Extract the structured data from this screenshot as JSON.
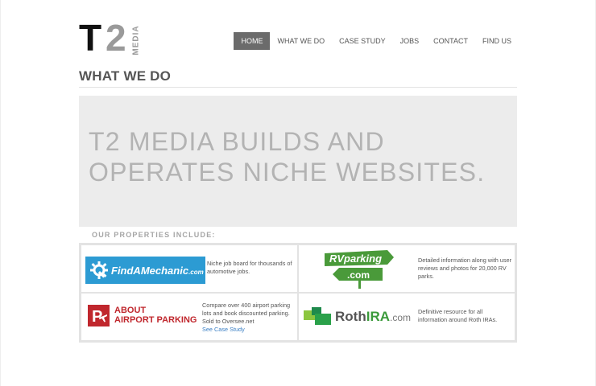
{
  "logo": {
    "t": "T",
    "two": "2",
    "media": "MEDIA"
  },
  "nav": {
    "items": [
      {
        "label": "HOME",
        "active": true
      },
      {
        "label": "WHAT WE DO"
      },
      {
        "label": "CASE STUDY"
      },
      {
        "label": "JOBS"
      },
      {
        "label": "CONTACT"
      },
      {
        "label": "FIND US"
      }
    ]
  },
  "section_title": "WHAT WE DO",
  "hero": {
    "line1": "T2 MEDIA BUILDS AND",
    "line2": "OPERATES NICHE WEBSITES."
  },
  "properties": {
    "label": "OUR PROPERTIES INCLUDE:",
    "items": [
      {
        "logo_name": "FindAMechanic",
        "logo_suffix": ".com",
        "desc": "Niche job board for thousands of automotive jobs."
      },
      {
        "logo_line1": "RVparking",
        "logo_line2": ".com",
        "desc": "Detailed information along with user reviews and photos for 20,000 RV parks."
      },
      {
        "logo_line1": "ABOUT",
        "logo_line2": "AIRPORT PARKING",
        "logo_letter": "P",
        "desc": "Compare over 400 airport parking lots and book discounted parking. Sold to Oversee.net",
        "link": "See Case Study"
      },
      {
        "logo_roth": "Roth",
        "logo_ira": "IRA",
        "logo_suffix": ".com",
        "desc": "Definitive resource for all information around Roth IRAs."
      }
    ]
  },
  "colors": {
    "nav_active": "#6b6b6b",
    "hero_bg": "#ececec",
    "mechanic_blue": "#2c9bd3",
    "rv_green": "#4a9a3a",
    "airport_red": "#c0272d",
    "roth_green": "#3a9a3a",
    "link_blue": "#3a7fc4"
  }
}
